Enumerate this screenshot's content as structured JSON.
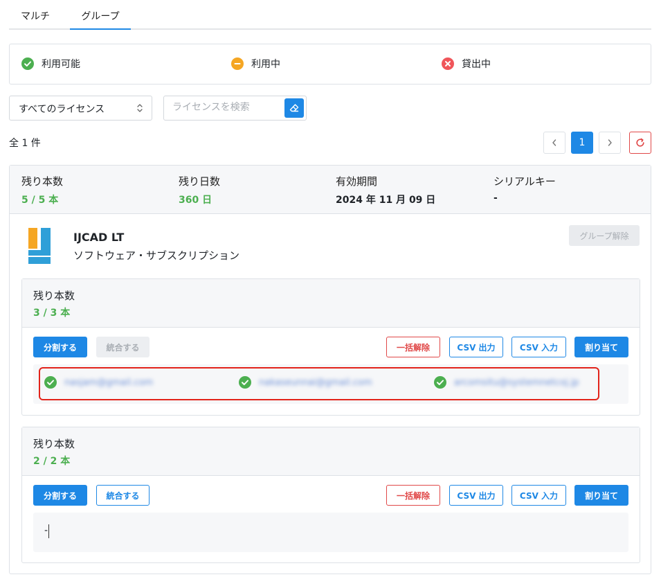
{
  "tabs": [
    {
      "label": "マルチ"
    },
    {
      "label": "グループ"
    }
  ],
  "legend": {
    "available": "利用可能",
    "in_use": "利用中",
    "lending": "貸出中"
  },
  "filter": {
    "select_value": "すべてのライセンス",
    "search_placeholder": "ライセンスを検索"
  },
  "result_count": "全 1 件",
  "pagination": {
    "current_page": "1"
  },
  "license": {
    "remaining_label": "残り本数",
    "remaining_value": "5 / 5 本",
    "days_label": "残り日数",
    "days_value": "360 日",
    "period_label": "有効期間",
    "period_value": "2024 年 11 月 09 日",
    "serial_label": "シリアルキー",
    "serial_value": "-",
    "product_name": "IJCAD LT",
    "product_type": "ソフトウェア・サブスクリプション",
    "ungroup_label": "グループ解除"
  },
  "groups": [
    {
      "remaining_label": "残り本数",
      "remaining_value": "3 / 3 本",
      "buttons": {
        "split": "分割する",
        "merge": "統合する",
        "release_all": "一括解除",
        "csv_out": "CSV 出力",
        "csv_in": "CSV 入力",
        "assign": "割り当て"
      },
      "users": [
        {
          "email": "nasjam@gmail.com"
        },
        {
          "email": "nakaseunnai@gmail.com"
        },
        {
          "email": "arcomsitu@systemnetcoj.jp"
        }
      ]
    },
    {
      "remaining_label": "残り本数",
      "remaining_value": "2 / 2 本",
      "buttons": {
        "split": "分割する",
        "merge": "統合する",
        "release_all": "一括解除",
        "csv_out": "CSV 出力",
        "csv_in": "CSV 入力",
        "assign": "割り当て"
      },
      "empty_text": "-"
    }
  ],
  "colors": {
    "accent": "#1e88e5",
    "available": "#4caf50",
    "in_use": "#f5a623",
    "lending": "#f0555a",
    "danger": "#e04848",
    "highlight": "#e2231a"
  },
  "icons": {
    "available": "check-circle-icon",
    "in_use": "minus-circle-icon",
    "lending": "x-circle-icon",
    "select": "chevron-up-down-icon",
    "search_clear": "eraser-icon",
    "prev": "chevron-left-icon",
    "next": "chevron-right-icon",
    "refresh": "refresh-icon",
    "product": "ijcad-logo-icon"
  }
}
